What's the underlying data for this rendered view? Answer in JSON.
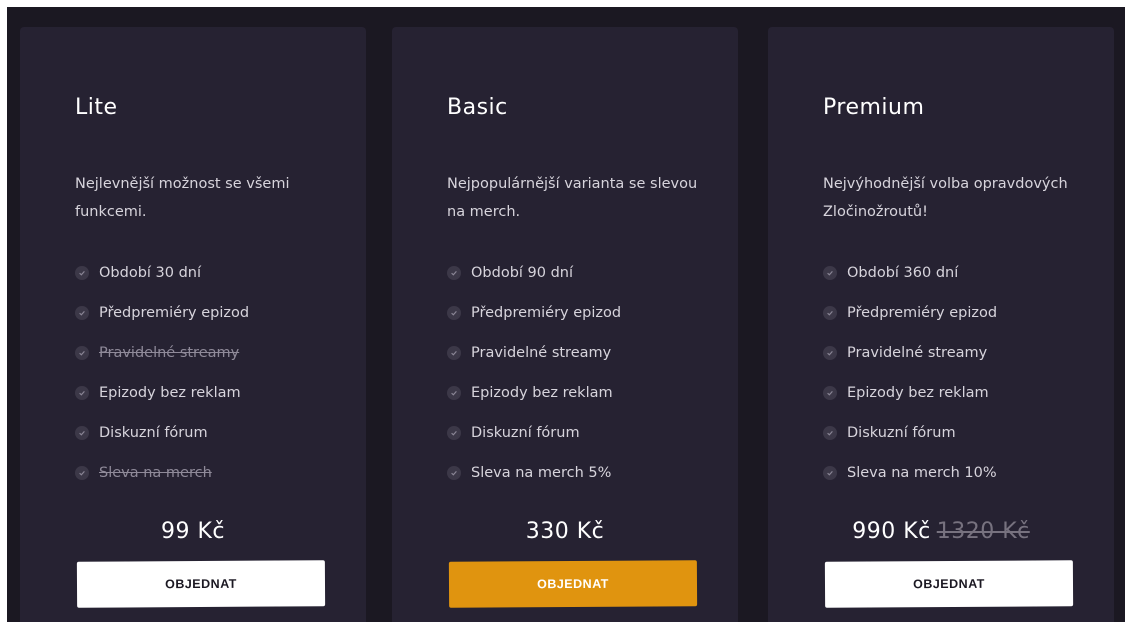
{
  "colors": {
    "background": "#1b1822",
    "card": "#262232",
    "accent": "#e0940f",
    "text": "#d7d4dc",
    "muted": "#8f8a99"
  },
  "plans": [
    {
      "name": "Lite",
      "description": "Nejlevnější možnost se všemi funkcemi.",
      "features": [
        {
          "label": "Období 30 dní",
          "enabled": true
        },
        {
          "label": "Předpremiéry epizod",
          "enabled": true
        },
        {
          "label": "Pravidelné streamy",
          "enabled": false
        },
        {
          "label": "Epizody bez reklam",
          "enabled": true
        },
        {
          "label": "Diskuzní fórum",
          "enabled": true
        },
        {
          "label": "Sleva na merch",
          "enabled": false
        }
      ],
      "price": "99 Kč",
      "old_price": "",
      "button": "OBJEDNAT",
      "button_style": "white"
    },
    {
      "name": "Basic",
      "description": "Nejpopulárnější varianta se slevou na merch.",
      "features": [
        {
          "label": "Období 90 dní",
          "enabled": true
        },
        {
          "label": "Předpremiéry epizod",
          "enabled": true
        },
        {
          "label": "Pravidelné streamy",
          "enabled": true
        },
        {
          "label": "Epizody bez reklam",
          "enabled": true
        },
        {
          "label": "Diskuzní fórum",
          "enabled": true
        },
        {
          "label": "Sleva na merch 5%",
          "enabled": true
        }
      ],
      "price": "330 Kč",
      "old_price": "",
      "button": "OBJEDNAT",
      "button_style": "accent"
    },
    {
      "name": "Premium",
      "description": "Nejvýhodnější volba opravdových Zločinožroutů!",
      "features": [
        {
          "label": "Období 360 dní",
          "enabled": true
        },
        {
          "label": "Předpremiéry epizod",
          "enabled": true
        },
        {
          "label": "Pravidelné streamy",
          "enabled": true
        },
        {
          "label": "Epizody bez reklam",
          "enabled": true
        },
        {
          "label": "Diskuzní fórum",
          "enabled": true
        },
        {
          "label": "Sleva na merch 10%",
          "enabled": true
        }
      ],
      "price": "990 Kč",
      "old_price": "1320 Kč",
      "button": "OBJEDNAT",
      "button_style": "white"
    }
  ]
}
